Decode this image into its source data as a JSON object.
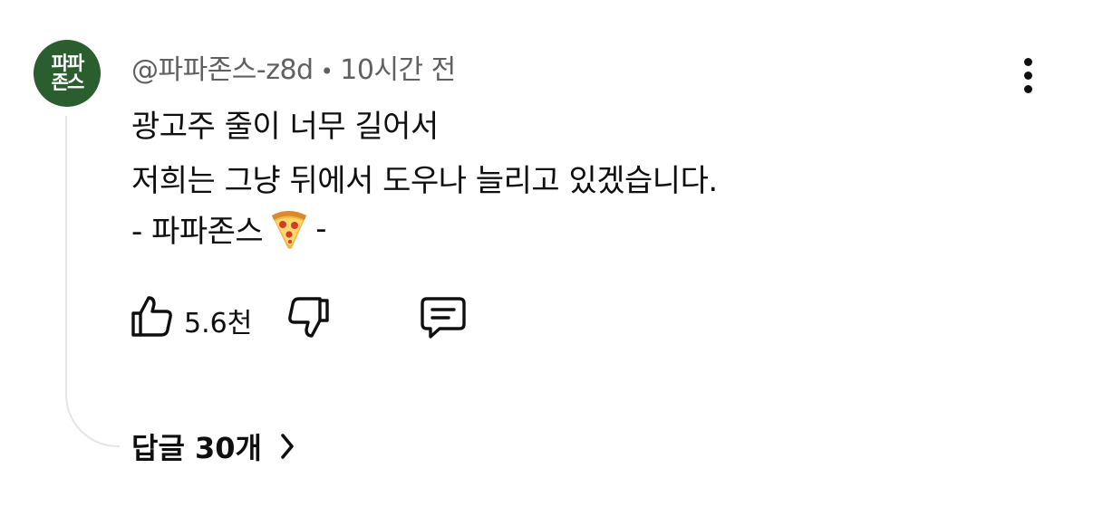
{
  "comment": {
    "avatar_text_line1": "파파",
    "avatar_text_line2": "존스",
    "author": "@파파존스-z8d",
    "separator": "•",
    "time": "10시간 전",
    "lines": [
      "광고주 줄이 너무 길어서",
      "저희는 그냥 뒤에서 도우나 늘리고 있겠습니다.",
      "- 파파존스",
      "-"
    ],
    "emoji": "pizza-emoji",
    "likes": "5.6천",
    "replies_label": "답글 30개"
  },
  "icons": {
    "like": "thumbs-up-icon",
    "dislike": "thumbs-down-icon",
    "reply": "comment-icon",
    "more": "more-vertical-icon",
    "chevron": "chevron-right-icon"
  },
  "colors": {
    "avatar_bg": "#2a5e2f",
    "meta_text": "#606060",
    "thread_line": "#e5e5e5"
  }
}
